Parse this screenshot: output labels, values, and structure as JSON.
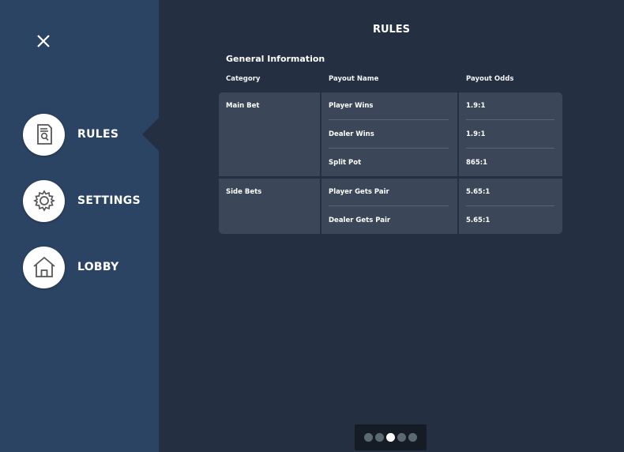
{
  "sidebar": {
    "items": [
      {
        "label": "RULES",
        "icon": "rules-icon",
        "active": true
      },
      {
        "label": "SETTINGS",
        "icon": "gear-icon",
        "active": false
      },
      {
        "label": "LOBBY",
        "icon": "home-icon",
        "active": false
      }
    ]
  },
  "page": {
    "title": "RULES",
    "section_title": "General Information"
  },
  "table": {
    "headers": [
      "Category",
      "Payout Name",
      "Payout Odds"
    ],
    "groups": [
      {
        "category": "Main Bet",
        "rows": [
          {
            "name": "Player Wins",
            "odds": "1.9:1"
          },
          {
            "name": "Dealer Wins",
            "odds": "1.9:1"
          },
          {
            "name": "Split Pot",
            "odds": "865:1"
          }
        ]
      },
      {
        "category": "Side Bets",
        "rows": [
          {
            "name": "Player Gets Pair",
            "odds": "5.65:1"
          },
          {
            "name": "Dealer Gets Pair",
            "odds": "5.65:1"
          }
        ]
      }
    ]
  },
  "pager": {
    "page_count": 5,
    "active_page": 3
  },
  "colors": {
    "sidebar_bg": "#2c4464",
    "main_bg": "#242f42",
    "cell_bg": "#3b4759",
    "pager_bg": "#161c25"
  }
}
